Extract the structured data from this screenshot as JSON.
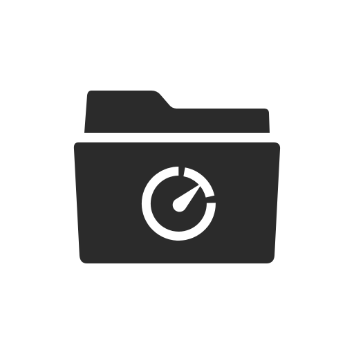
{
  "icon": {
    "name": "folder-speedometer-icon",
    "parts": {
      "folder_back": "folder-back-icon",
      "folder_front": "folder-front-icon",
      "gauge": "speedometer-icon"
    }
  },
  "colors": {
    "background": "#ffffff",
    "folder": "#2b2b2b",
    "gauge": "#ffffff"
  }
}
